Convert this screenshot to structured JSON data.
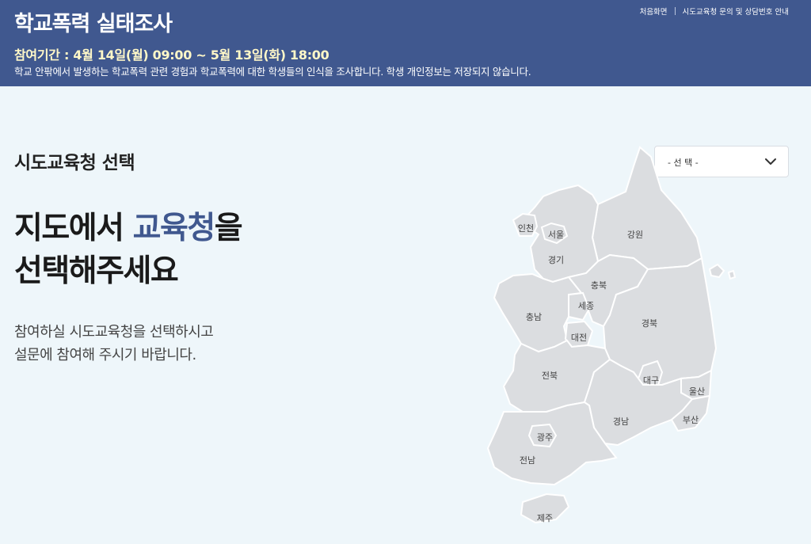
{
  "header": {
    "title": "학교폭력 실태조사",
    "period": "참여기간 : 4월 14일(월) 09:00 ~ 5월 13일(화) 18:00",
    "description": "학교 안팎에서 발생하는 학교폭력 관련 경험과 학교폭력에 대한 학생들의 인식을 조사합니다. 학생 개인정보는 저장되지 않습니다.",
    "nav": {
      "home": "처음화면",
      "contact": "시도교육청 문의 및 상담번호 안내"
    }
  },
  "main": {
    "section_label": "시도교육청 선택",
    "headline_prefix": "지도에서 ",
    "headline_accent": "교육청",
    "headline_suffix": "을",
    "headline_line2": "선택해주세요",
    "subtext_line1": "참여하실 시도교육청을 선택하시고",
    "subtext_line2": "설문에 참여해 주시기 바랍니다."
  },
  "select": {
    "value": "- 선 택 -",
    "icon": "chevron-down-icon"
  },
  "map": {
    "regions": {
      "incheon": "인천",
      "seoul": "서울",
      "gyeonggi": "경기",
      "gangwon": "강원",
      "chungbuk": "충북",
      "sejong": "세종",
      "chungnam": "충남",
      "daejeon": "대전",
      "gyeongbuk": "경북",
      "jeonbuk": "전북",
      "daegu": "대구",
      "ulsan": "울산",
      "gyeongnam": "경남",
      "busan": "부산",
      "gwangju": "광주",
      "jeonnam": "전남",
      "jeju": "제주"
    }
  },
  "colors": {
    "header_bg": "#40588f",
    "period_text": "#fff8c8",
    "accent": "#40588f",
    "page_bg": "#eef6fa",
    "map_region": "#dbdde0"
  }
}
